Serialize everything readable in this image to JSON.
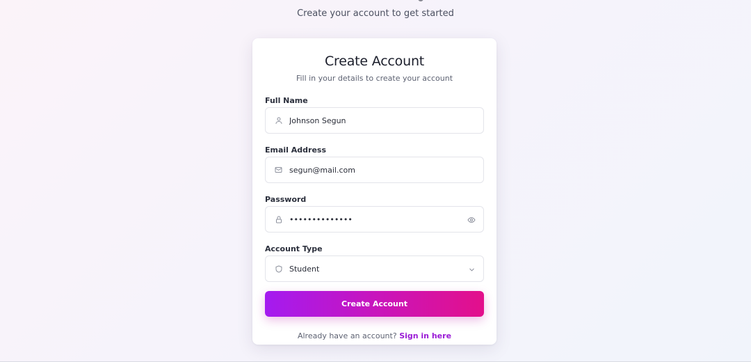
{
  "page": {
    "subtitle": "Create your account to get started"
  },
  "card": {
    "title": "Create Account",
    "description": "Fill in your details to create your account"
  },
  "form": {
    "full_name": {
      "label": "Full Name",
      "value": "Johnson Segun",
      "icon": "user-icon"
    },
    "email": {
      "label": "Email Address",
      "value": "segun@mail.com",
      "icon": "mail-icon"
    },
    "password": {
      "label": "Password",
      "value": "••••••••••••••",
      "icon": "lock-icon",
      "toggle_icon": "eye-icon"
    },
    "account_type": {
      "label": "Account Type",
      "value": "Student",
      "icon": "shield-icon",
      "dropdown_icon": "chevron-down-icon"
    }
  },
  "submit": {
    "label": "Create Account"
  },
  "footer": {
    "prompt": "Already have an account?",
    "link": "Sign in here"
  },
  "colors": {
    "gradient_start": "#a41bf0",
    "gradient_end": "#e3108b",
    "link": "#9a1bd6"
  }
}
